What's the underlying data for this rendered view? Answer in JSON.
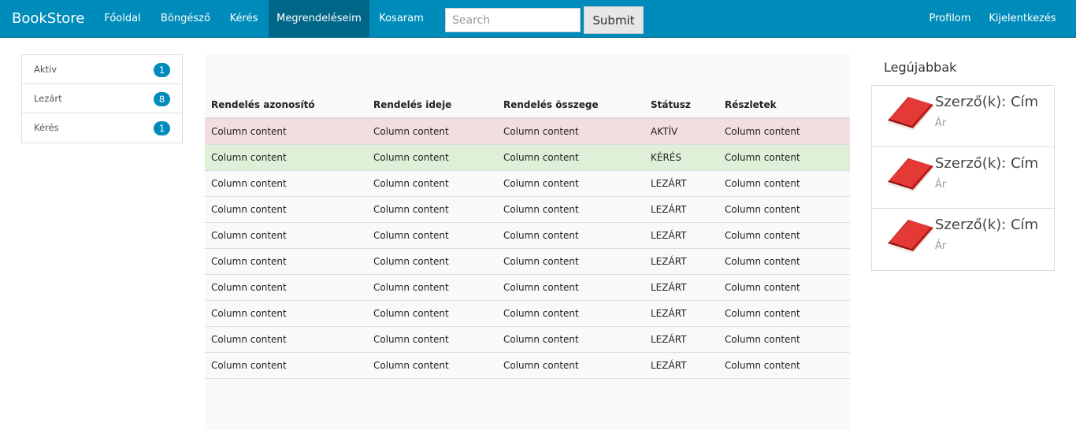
{
  "navbar": {
    "brand": "BookStore",
    "items": [
      {
        "label": "Főoldal"
      },
      {
        "label": "Böngésző"
      },
      {
        "label": "Kérés"
      },
      {
        "label": "Megrendeléseim"
      },
      {
        "label": "Kosaram"
      }
    ],
    "search_placeholder": "Search",
    "submit_label": "Submit",
    "right_items": [
      {
        "label": "Profilom"
      },
      {
        "label": "Kijelentkezés"
      }
    ],
    "active_item": "Megrendeléseim"
  },
  "sidebar": {
    "items": [
      {
        "label": "Aktív",
        "count": "1"
      },
      {
        "label": "Lezárt",
        "count": "8"
      },
      {
        "label": "Kérés",
        "count": "1"
      }
    ]
  },
  "orders": {
    "columns": [
      "Rendelés azonosító",
      "Rendelés ideje",
      "Rendelés összege",
      "Státusz",
      "Részletek"
    ],
    "rows": [
      {
        "id": "Column content",
        "time": "Column content",
        "total": "Column content",
        "status": "AKTÍV",
        "details": "Column content"
      },
      {
        "id": "Column content",
        "time": "Column content",
        "total": "Column content",
        "status": "KÉRÉS",
        "details": "Column content"
      },
      {
        "id": "Column content",
        "time": "Column content",
        "total": "Column content",
        "status": "LEZÁRT",
        "details": "Column content"
      },
      {
        "id": "Column content",
        "time": "Column content",
        "total": "Column content",
        "status": "LEZÁRT",
        "details": "Column content"
      },
      {
        "id": "Column content",
        "time": "Column content",
        "total": "Column content",
        "status": "LEZÁRT",
        "details": "Column content"
      },
      {
        "id": "Column content",
        "time": "Column content",
        "total": "Column content",
        "status": "LEZÁRT",
        "details": "Column content"
      },
      {
        "id": "Column content",
        "time": "Column content",
        "total": "Column content",
        "status": "LEZÁRT",
        "details": "Column content"
      },
      {
        "id": "Column content",
        "time": "Column content",
        "total": "Column content",
        "status": "LEZÁRT",
        "details": "Column content"
      },
      {
        "id": "Column content",
        "time": "Column content",
        "total": "Column content",
        "status": "LEZÁRT",
        "details": "Column content"
      },
      {
        "id": "Column content",
        "time": "Column content",
        "total": "Column content",
        "status": "LEZÁRT",
        "details": "Column content"
      }
    ]
  },
  "newest": {
    "title": "Legújabbak",
    "items": [
      {
        "title": "Szerző(k): Cím",
        "price": "Ár",
        "icon": "book-icon"
      },
      {
        "title": "Szerző(k): Cím",
        "price": "Ár",
        "icon": "book-icon"
      },
      {
        "title": "Szerző(k): Cím",
        "price": "Ár",
        "icon": "book-icon"
      }
    ]
  },
  "colors": {
    "navbar": "#008cba",
    "navbar_active": "#006687",
    "badge": "#008cba",
    "row_danger": "#f2dede",
    "row_success": "#dff0d8",
    "book_red": "#d9262b"
  }
}
